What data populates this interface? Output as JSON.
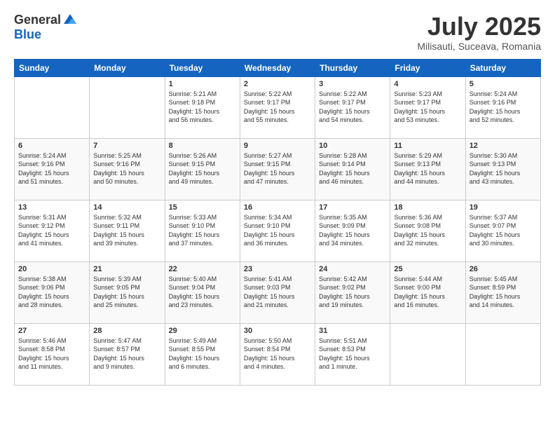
{
  "logo": {
    "general": "General",
    "blue": "Blue"
  },
  "title": "July 2025",
  "location": "Milisauti, Suceava, Romania",
  "days_of_week": [
    "Sunday",
    "Monday",
    "Tuesday",
    "Wednesday",
    "Thursday",
    "Friday",
    "Saturday"
  ],
  "weeks": [
    [
      {
        "day": "",
        "info": ""
      },
      {
        "day": "",
        "info": ""
      },
      {
        "day": "1",
        "info": "Sunrise: 5:21 AM\nSunset: 9:18 PM\nDaylight: 15 hours\nand 56 minutes."
      },
      {
        "day": "2",
        "info": "Sunrise: 5:22 AM\nSunset: 9:17 PM\nDaylight: 15 hours\nand 55 minutes."
      },
      {
        "day": "3",
        "info": "Sunrise: 5:22 AM\nSunset: 9:17 PM\nDaylight: 15 hours\nand 54 minutes."
      },
      {
        "day": "4",
        "info": "Sunrise: 5:23 AM\nSunset: 9:17 PM\nDaylight: 15 hours\nand 53 minutes."
      },
      {
        "day": "5",
        "info": "Sunrise: 5:24 AM\nSunset: 9:16 PM\nDaylight: 15 hours\nand 52 minutes."
      }
    ],
    [
      {
        "day": "6",
        "info": "Sunrise: 5:24 AM\nSunset: 9:16 PM\nDaylight: 15 hours\nand 51 minutes."
      },
      {
        "day": "7",
        "info": "Sunrise: 5:25 AM\nSunset: 9:16 PM\nDaylight: 15 hours\nand 50 minutes."
      },
      {
        "day": "8",
        "info": "Sunrise: 5:26 AM\nSunset: 9:15 PM\nDaylight: 15 hours\nand 49 minutes."
      },
      {
        "day": "9",
        "info": "Sunrise: 5:27 AM\nSunset: 9:15 PM\nDaylight: 15 hours\nand 47 minutes."
      },
      {
        "day": "10",
        "info": "Sunrise: 5:28 AM\nSunset: 9:14 PM\nDaylight: 15 hours\nand 46 minutes."
      },
      {
        "day": "11",
        "info": "Sunrise: 5:29 AM\nSunset: 9:13 PM\nDaylight: 15 hours\nand 44 minutes."
      },
      {
        "day": "12",
        "info": "Sunrise: 5:30 AM\nSunset: 9:13 PM\nDaylight: 15 hours\nand 43 minutes."
      }
    ],
    [
      {
        "day": "13",
        "info": "Sunrise: 5:31 AM\nSunset: 9:12 PM\nDaylight: 15 hours\nand 41 minutes."
      },
      {
        "day": "14",
        "info": "Sunrise: 5:32 AM\nSunset: 9:11 PM\nDaylight: 15 hours\nand 39 minutes."
      },
      {
        "day": "15",
        "info": "Sunrise: 5:33 AM\nSunset: 9:10 PM\nDaylight: 15 hours\nand 37 minutes."
      },
      {
        "day": "16",
        "info": "Sunrise: 5:34 AM\nSunset: 9:10 PM\nDaylight: 15 hours\nand 36 minutes."
      },
      {
        "day": "17",
        "info": "Sunrise: 5:35 AM\nSunset: 9:09 PM\nDaylight: 15 hours\nand 34 minutes."
      },
      {
        "day": "18",
        "info": "Sunrise: 5:36 AM\nSunset: 9:08 PM\nDaylight: 15 hours\nand 32 minutes."
      },
      {
        "day": "19",
        "info": "Sunrise: 5:37 AM\nSunset: 9:07 PM\nDaylight: 15 hours\nand 30 minutes."
      }
    ],
    [
      {
        "day": "20",
        "info": "Sunrise: 5:38 AM\nSunset: 9:06 PM\nDaylight: 15 hours\nand 28 minutes."
      },
      {
        "day": "21",
        "info": "Sunrise: 5:39 AM\nSunset: 9:05 PM\nDaylight: 15 hours\nand 25 minutes."
      },
      {
        "day": "22",
        "info": "Sunrise: 5:40 AM\nSunset: 9:04 PM\nDaylight: 15 hours\nand 23 minutes."
      },
      {
        "day": "23",
        "info": "Sunrise: 5:41 AM\nSunset: 9:03 PM\nDaylight: 15 hours\nand 21 minutes."
      },
      {
        "day": "24",
        "info": "Sunrise: 5:42 AM\nSunset: 9:02 PM\nDaylight: 15 hours\nand 19 minutes."
      },
      {
        "day": "25",
        "info": "Sunrise: 5:44 AM\nSunset: 9:00 PM\nDaylight: 15 hours\nand 16 minutes."
      },
      {
        "day": "26",
        "info": "Sunrise: 5:45 AM\nSunset: 8:59 PM\nDaylight: 15 hours\nand 14 minutes."
      }
    ],
    [
      {
        "day": "27",
        "info": "Sunrise: 5:46 AM\nSunset: 8:58 PM\nDaylight: 15 hours\nand 11 minutes."
      },
      {
        "day": "28",
        "info": "Sunrise: 5:47 AM\nSunset: 8:57 PM\nDaylight: 15 hours\nand 9 minutes."
      },
      {
        "day": "29",
        "info": "Sunrise: 5:49 AM\nSunset: 8:55 PM\nDaylight: 15 hours\nand 6 minutes."
      },
      {
        "day": "30",
        "info": "Sunrise: 5:50 AM\nSunset: 8:54 PM\nDaylight: 15 hours\nand 4 minutes."
      },
      {
        "day": "31",
        "info": "Sunrise: 5:51 AM\nSunset: 8:53 PM\nDaylight: 15 hours\nand 1 minute."
      },
      {
        "day": "",
        "info": ""
      },
      {
        "day": "",
        "info": ""
      }
    ]
  ]
}
